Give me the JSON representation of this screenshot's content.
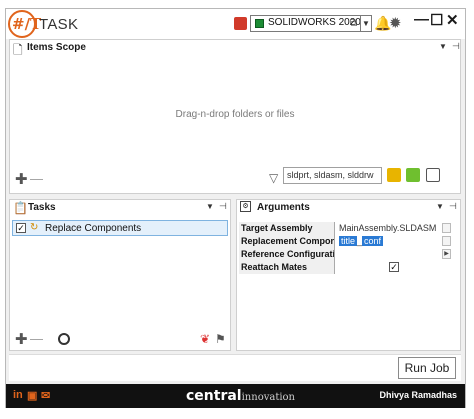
{
  "app": {
    "title": "TASK",
    "logo_text": "#/T"
  },
  "titlebar": {
    "version": "SOLIDWORKS 2020",
    "minimize": "—",
    "maximize": "☐",
    "close": "✕"
  },
  "items_scope": {
    "title": "Items Scope",
    "drop_hint": "Drag-n-drop folders or files",
    "filter_value": "sldprt, sldasm, slddrw"
  },
  "tasks": {
    "title": "Tasks",
    "items": [
      {
        "label": "Replace Components",
        "checked": true
      }
    ]
  },
  "arguments": {
    "title": "Arguments",
    "rows": [
      {
        "name": "Target Assembly",
        "value": "MainAssembly.SLDASM"
      },
      {
        "name": "Replacement Component",
        "token1": "title",
        "sep": "_",
        "token2": "conf"
      },
      {
        "name": "Reference Configuration",
        "value": ""
      },
      {
        "name": "Reattach Mates",
        "checked": true
      }
    ]
  },
  "run_job": {
    "label": "Run Job"
  },
  "footer": {
    "brand_bold": "central",
    "brand_light": "innovation",
    "user": "Dhivya Ramadhas"
  },
  "colors": {
    "accent": "#e0641c",
    "footer_bg": "#111111",
    "selection": "#e4f0fb",
    "token": "#2a7ad4"
  },
  "icons": [
    "task-logo-icon",
    "solidworks-icon",
    "bell-icon",
    "gear-icon",
    "document-icon",
    "clipboard-icon",
    "arguments-icon",
    "filter-icon",
    "add-icon",
    "remove-icon",
    "globe-icon",
    "linkedin-icon",
    "youtube-icon",
    "email-icon"
  ]
}
